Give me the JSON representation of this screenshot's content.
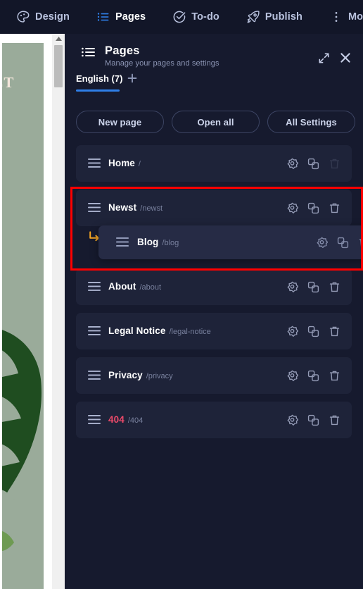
{
  "topbar": {
    "items": [
      {
        "label": "Design",
        "icon": "palette-icon",
        "active": false
      },
      {
        "label": "Pages",
        "icon": "list-icon",
        "active": true
      },
      {
        "label": "To-do",
        "icon": "check-circle-icon",
        "active": false
      },
      {
        "label": "Publish",
        "icon": "rocket-icon",
        "active": false
      },
      {
        "label": "More",
        "icon": "dots-vertical-icon",
        "active": false
      }
    ]
  },
  "canvas": {
    "headline": "ACT",
    "page_bg_color": "#9aab9a",
    "leaf_image": "monstera-leaf"
  },
  "panel": {
    "title": "Pages",
    "subtitle": "Manage your pages and settings",
    "header_icon": "list-icon",
    "expand_icon": "expand-icon",
    "close_icon": "close-icon",
    "language_tab": "English (7)",
    "add_language_icon": "plus-icon",
    "accent_color": "#2f7fe8",
    "buttons": [
      {
        "label": "New page"
      },
      {
        "label": "Open all"
      },
      {
        "label": "All Settings"
      }
    ],
    "row_actions": {
      "settings_icon": "gear-icon",
      "duplicate_icon": "duplicate-icon",
      "delete_icon": "trash-icon"
    },
    "pages": [
      {
        "title": "Home",
        "slug": "/",
        "error": false,
        "delete_disabled": true,
        "nested": null
      },
      {
        "title": "Newst",
        "slug": "/newst",
        "error": false,
        "delete_disabled": false,
        "nested": {
          "title": "Blog",
          "slug": "/blog",
          "indent_icon": "arrow-turn-down-right-icon"
        }
      },
      {
        "title": "About",
        "slug": "/about",
        "error": false,
        "delete_disabled": false,
        "nested": null
      },
      {
        "title": "Legal Notice",
        "slug": "/legal-notice",
        "error": false,
        "delete_disabled": false,
        "nested": null
      },
      {
        "title": "Privacy",
        "slug": "/privacy",
        "error": false,
        "delete_disabled": false,
        "nested": null
      },
      {
        "title": "404",
        "slug": "/404",
        "error": true,
        "delete_disabled": false,
        "nested": null
      }
    ]
  },
  "annotation": {
    "highlight_color": "#fe0000"
  }
}
